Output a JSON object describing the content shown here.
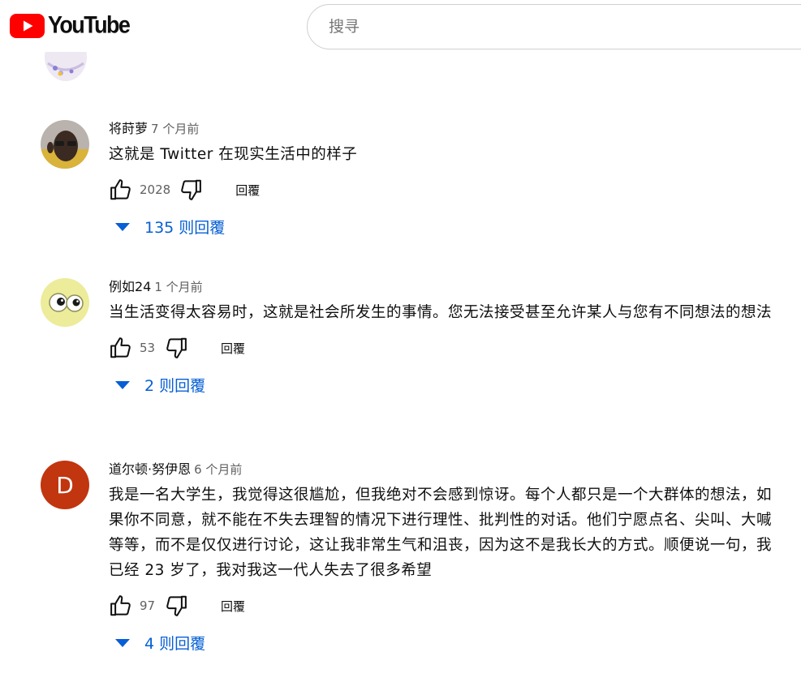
{
  "header": {
    "logo_text": "YouTube",
    "search_placeholder": "搜寻"
  },
  "colors": {
    "brand_red": "#ff0000",
    "link_blue": "#065fd4",
    "secondary_text": "#606060",
    "avatar_d": "#c1350f"
  },
  "comments": [
    {
      "author": "将莳萝",
      "time": "7 个月前",
      "text": "这就是 Twitter 在现实生活中的样子",
      "likes": "2028",
      "reply_label": "回覆",
      "replies_label": "135 则回覆"
    },
    {
      "author": "例如24",
      "time": "1 个月前",
      "text": "当生活变得太容易时，这就是社会所发生的事情。您无法接受甚至允许某人与您有不同想法的想法",
      "likes": "53",
      "reply_label": "回覆",
      "replies_label": "2 则回覆"
    },
    {
      "author": "道尔顿·努伊恩",
      "avatar_letter": "D",
      "time": "6 个月前",
      "text": "我是一名大学生，我觉得这很尴尬，但我绝对不会感到惊讶。每个人都只是一个大群体的想法，如果你不同意，就不能在不失去理智的情况下进行理性、批判性的对话。他们宁愿点名、尖叫、大喊等等，而不是仅仅进行讨论，这让我非常生气和沮丧，因为这不是我长大的方式。顺便说一句，我已经 23 岁了，我对我这一代人失去了很多希望",
      "likes": "97",
      "reply_label": "回覆",
      "replies_label": "4 则回覆"
    }
  ]
}
